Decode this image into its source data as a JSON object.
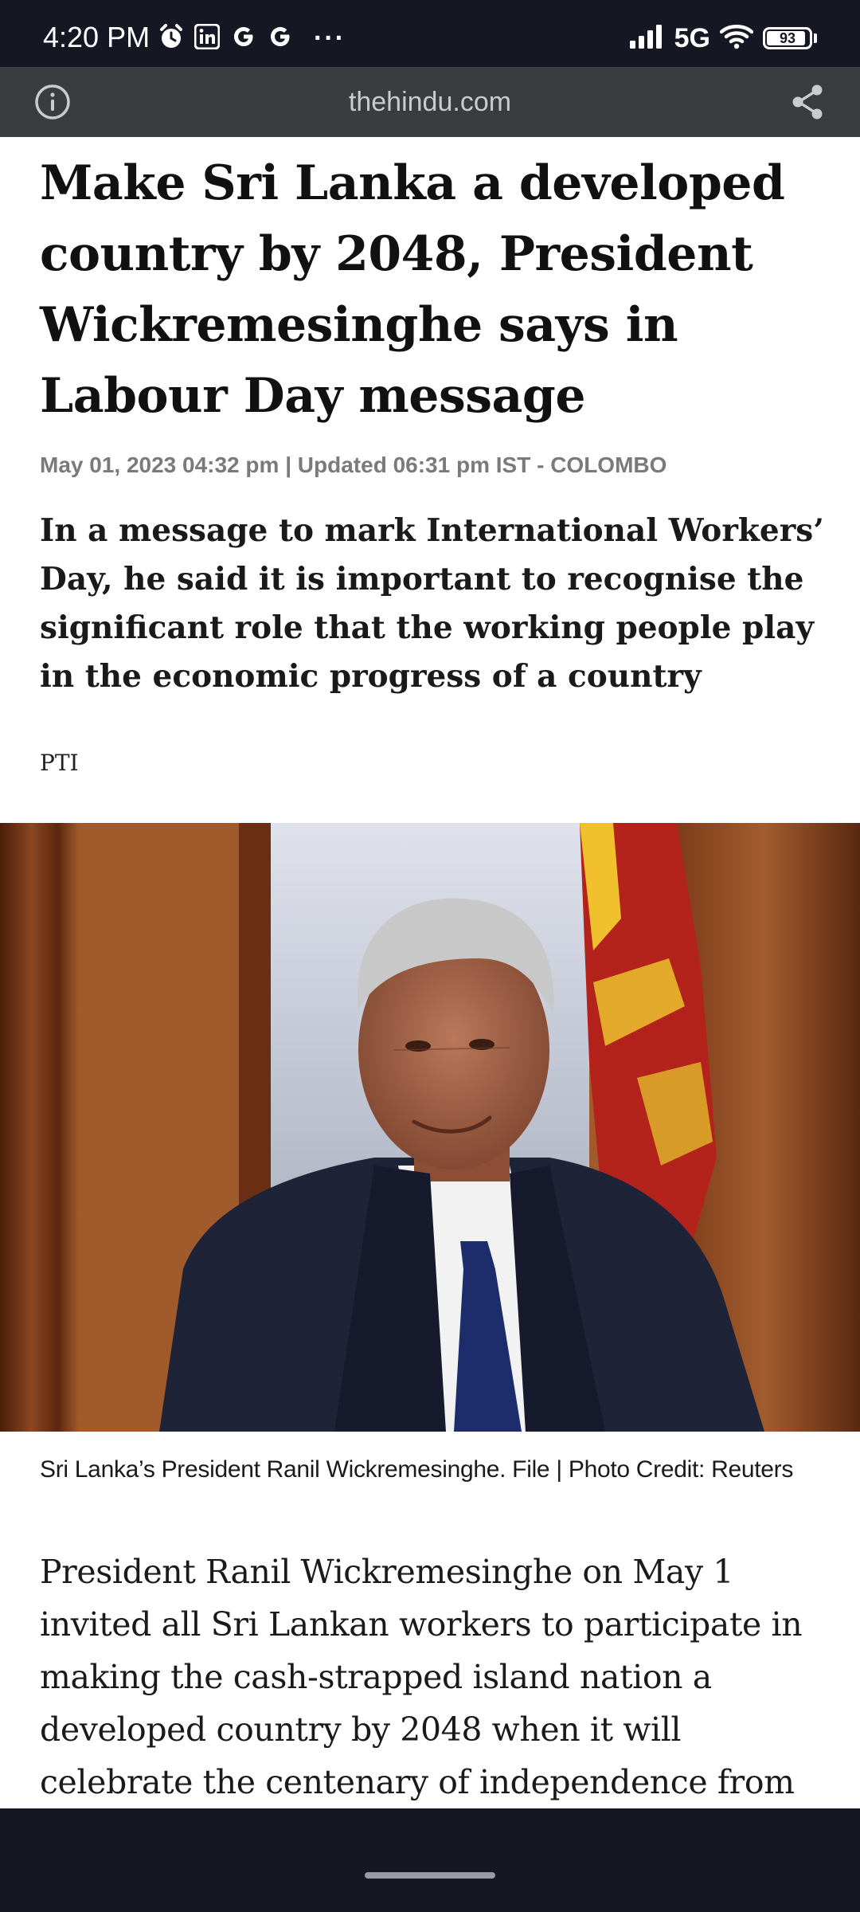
{
  "status_bar": {
    "time": "4:20 PM",
    "network": "5G",
    "battery": "93",
    "battery_level_percent": 93,
    "overflow": "···",
    "left_icons": [
      "alarm-icon",
      "linkedin-icon",
      "google-icon",
      "google-icon"
    ],
    "right_icons": [
      "signal-icon",
      "wifi-icon",
      "battery-icon"
    ]
  },
  "browser": {
    "url": "thehindu.com",
    "url_bar_color": "#3a3c40"
  },
  "article": {
    "headline": "Make Sri Lanka a developed country by 2048, President Wickremesinghe says in Labour Day message",
    "dateline": "May 01, 2023 04:32 pm | Updated 06:31 pm IST - COLOMBO",
    "summary": "In a message to mark International Workers’ Day, he said it is important to recognise the significant role that the working people play in the economic progress of a country",
    "byline": "PTI",
    "photo_caption": "Sri Lanka’s President Ranil Wickremesinghe. File | Photo Credit: Reuters",
    "body_paragraph": "President Ranil Wickremesinghe on May 1 invited all Sri Lankan workers to participate in making the cash-strapped island nation a developed country by 2048 when it will celebrate the centenary of independence from Britain."
  },
  "colors": {
    "status_bar_bg": "#151823",
    "headline_text": "#111111",
    "dateline_text": "#7a7a7a"
  }
}
